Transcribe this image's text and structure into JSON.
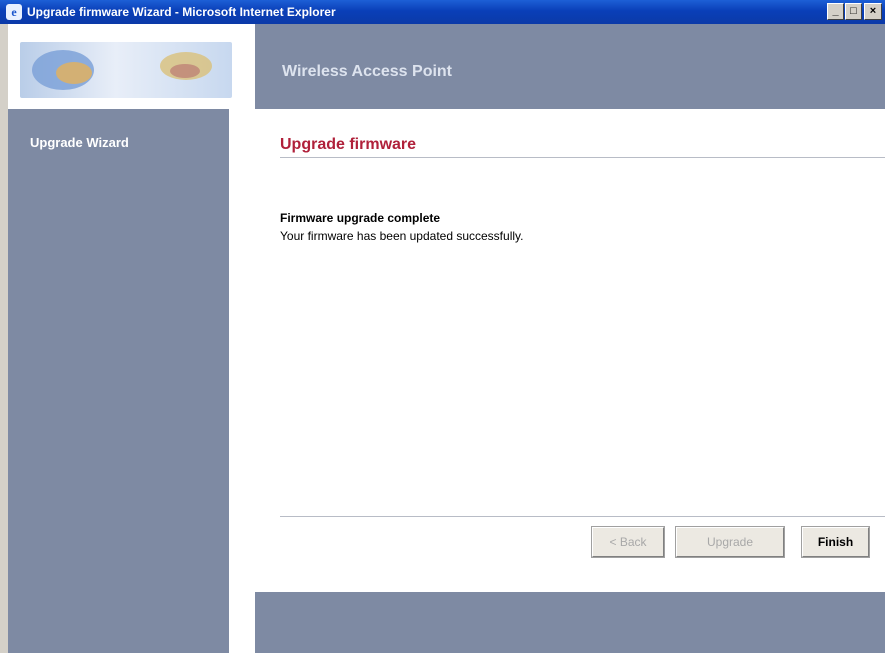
{
  "window": {
    "title": "Upgrade firmware Wizard - Microsoft Internet Explorer",
    "app_icon": "ie-icon",
    "controls": {
      "minimize": "_",
      "maximize": "□",
      "close": "×"
    }
  },
  "header": {
    "title": "Wireless Access Point"
  },
  "sidebar": {
    "items": [
      {
        "label": "Upgrade Wizard"
      }
    ]
  },
  "main": {
    "title": "Upgrade firmware",
    "status_heading": "Firmware upgrade complete",
    "status_text": "Your firmware has been updated successfully."
  },
  "buttons": {
    "back": {
      "label": "< Back",
      "enabled": false
    },
    "upgrade": {
      "label": "Upgrade",
      "enabled": false
    },
    "finish": {
      "label": "Finish",
      "enabled": true
    }
  },
  "colors": {
    "titlebar": "#0a3fb8",
    "panel": "#7e8aa3",
    "page_title": "#b0203a",
    "header_text": "#dde3ee"
  }
}
